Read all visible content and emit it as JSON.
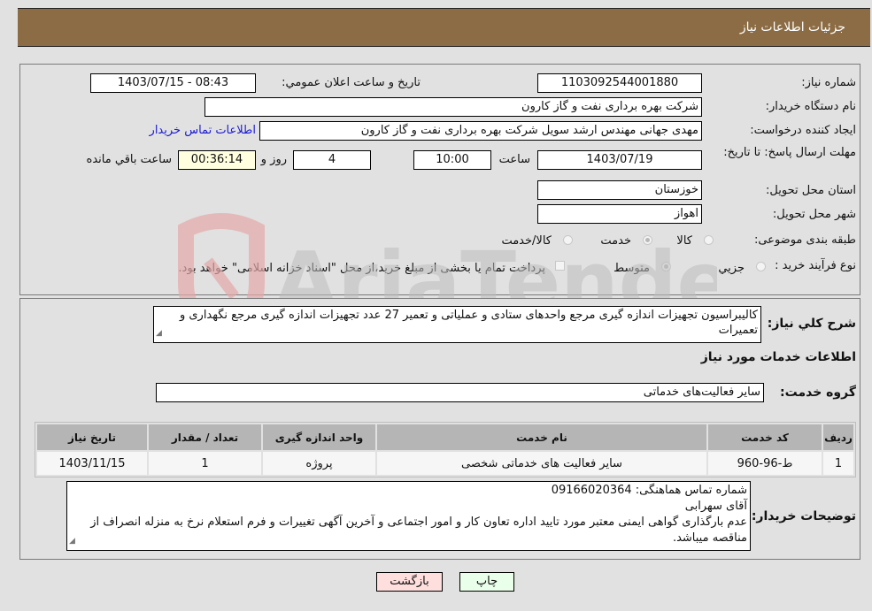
{
  "header": {
    "title": "جزئیات اطلاعات نیاز"
  },
  "form": {
    "need_number": {
      "label": "شماره نیاز:",
      "value": "1103092544001880"
    },
    "announce_datetime": {
      "label": "تاریخ و ساعت اعلان عمومي:",
      "value": "1403/07/15 - 08:43"
    },
    "buyer_org": {
      "label": "نام دستگاه خريدار:",
      "value": "شرکت بهره برداری نفت و گاز کارون"
    },
    "requester": {
      "label": "ایجاد کننده درخواست:",
      "value": "مهدی جهانی مهندس ارشد سویل شرکت بهره برداری نفت و گاز کارون"
    },
    "buyer_contact_link": "اطلاعات تماس خریدار",
    "deadline": {
      "label": "مهلت ارسال پاسخ: تا تاریخ:",
      "date": "1403/07/19",
      "time_label": "ساعت",
      "time": "10:00",
      "days": "4",
      "days_label": "روز و",
      "remaining": "00:36:14",
      "remaining_label": "ساعت باقي مانده"
    },
    "province": {
      "label": "استان محل تحویل:",
      "value": "خوزستان"
    },
    "city": {
      "label": "شهر محل تحویل:",
      "value": "اهواز"
    },
    "category": {
      "label": "طبقه بندی موضوعی:",
      "options": [
        "کالا",
        "خدمت",
        "کالا/خدمت"
      ],
      "selected": "خدمت"
    },
    "purchase_type": {
      "label": "نوع فرآیند خرید :",
      "options": [
        "جزيي",
        "متوسط"
      ],
      "selected": "متوسط",
      "treasury_checkbox_label": "پرداخت تمام یا بخشی از مبلغ خرید،از محل \"اسناد خزانه اسلامی\" خواهد بود.",
      "treasury_checked": false
    }
  },
  "description": {
    "label": "شرح کلي نياز:",
    "value": "کالیبراسیون تجهیزات اندازه گیری مرجع واحدهای ستادی و عملیاتی و تعمیر 27 عدد تجهیزات اندازه گیری مرجع نگهداری و تعمیرات"
  },
  "services_section_title": "اطلاعات خدمات مورد نیاز",
  "service_group": {
    "label": "گروه خدمت:",
    "value": "سایر فعالیت‌های خدماتی"
  },
  "table": {
    "headers": [
      "ردیف",
      "کد خدمت",
      "نام خدمت",
      "واحد اندازه گیری",
      "تعداد / مقدار",
      "تاریخ نیاز"
    ],
    "rows": [
      [
        "1",
        "ط-96-960",
        "سایر فعالیت های خدماتی شخصی",
        "پروژه",
        "1",
        "1403/11/15"
      ]
    ]
  },
  "buyer_notes": {
    "label": "توضیحات خریدار:",
    "lines": [
      "شماره تماس هماهنگی: 09166020364",
      "آقای سهرابی",
      "عدم بارگذاری گواهی ایمنی معتبر مورد تایید اداره تعاون کار و امور اجتماعی و آخرین آگهی تغییرات و فرم استعلام نرخ به منزله انصراف از مناقصه میباشد."
    ]
  },
  "buttons": {
    "print": "چاپ",
    "back": "بازگشت"
  },
  "watermark": "AriaTender.neT",
  "colors": {
    "header": "#8b6c44",
    "link": "#1a1ad6",
    "print_bg": "#eaffea",
    "back_bg": "#ffdede",
    "remaining_bg": "#ffffe0"
  }
}
